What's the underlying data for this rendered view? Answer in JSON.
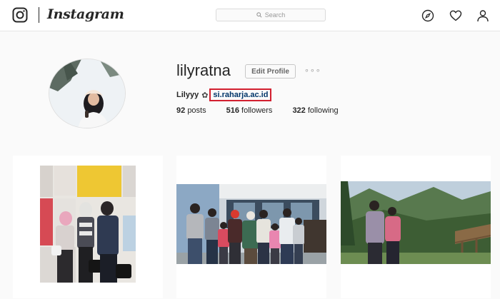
{
  "nav": {
    "brand": "Instagram",
    "search_placeholder": "Search"
  },
  "profile": {
    "username": "lilyratna",
    "edit_label": "Edit Profile",
    "more": "∘∘∘",
    "full_name": "Lilyyy",
    "bio_flower": "✿",
    "website": "si.raharja.ac.id",
    "stats": {
      "posts_count": "92",
      "posts_label": "posts",
      "followers_count": "516",
      "followers_label": "followers",
      "following_count": "322",
      "following_label": "following"
    }
  },
  "colors": {
    "highlight_border": "#d21f2f",
    "link": "#003569"
  },
  "icons": [
    "instagram-glyph-icon",
    "search-icon",
    "explore-compass-icon",
    "heart-icon",
    "person-icon"
  ]
}
